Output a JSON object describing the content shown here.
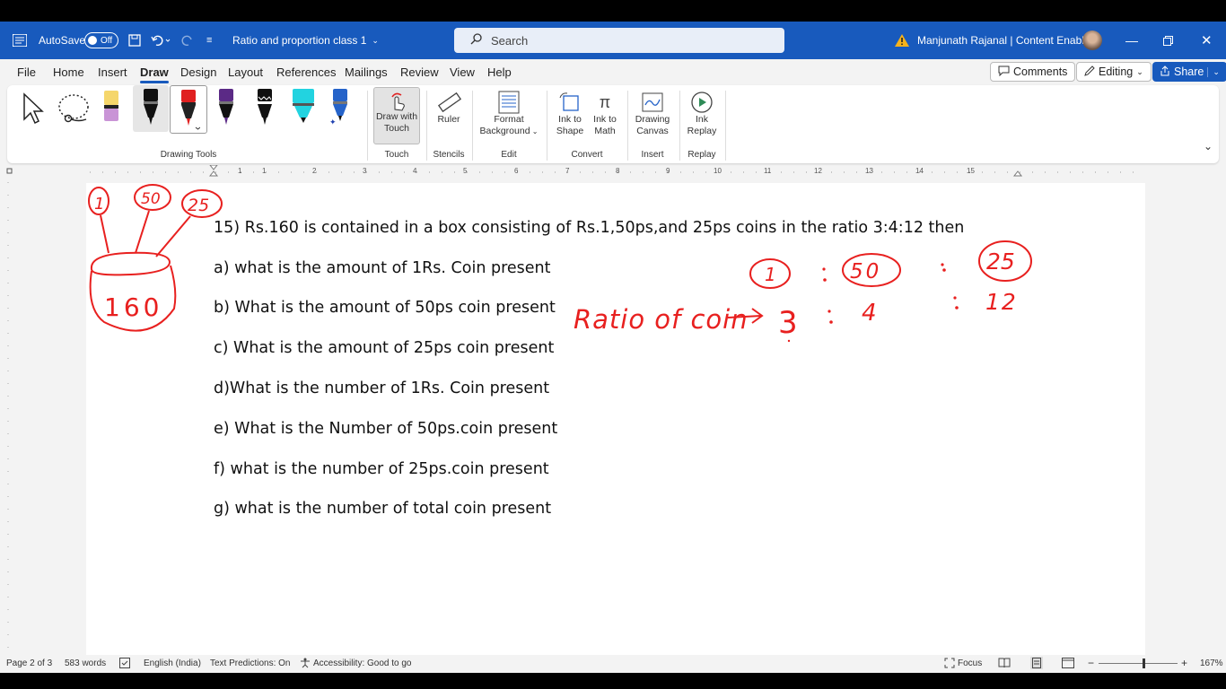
{
  "titlebar": {
    "autosave_label": "AutoSave",
    "autosave_state": "Off",
    "doc_title": "Ratio and proportion class 1",
    "search_placeholder": "Search",
    "user": "Manjunath Rajanal | Content Enablers"
  },
  "menu": {
    "tabs": [
      "File",
      "Home",
      "Insert",
      "Draw",
      "Design",
      "Layout",
      "References",
      "Mailings",
      "Review",
      "View",
      "Help"
    ],
    "active": "Draw",
    "comments_label": "Comments",
    "editing_label": "Editing",
    "share_label": "Share"
  },
  "ribbon": {
    "groups": {
      "drawing_tools": "Drawing Tools",
      "touch": "Touch",
      "stencils": "Stencils",
      "edit": "Edit",
      "convert": "Convert",
      "insert": "Insert",
      "replay": "Replay"
    },
    "buttons": {
      "draw_with_touch_1": "Draw with",
      "draw_with_touch_2": "Touch",
      "ruler": "Ruler",
      "format_bg_1": "Format",
      "format_bg_2": "Background",
      "ink_shape_1": "Ink to",
      "ink_shape_2": "Shape",
      "ink_math_1": "Ink to",
      "ink_math_2": "Math",
      "canvas_1": "Drawing",
      "canvas_2": "Canvas",
      "replay_1": "Ink",
      "replay_2": "Replay"
    },
    "pen_colors": [
      "#f5d66b",
      "#111111",
      "#e02020",
      "#5b2a86",
      "#111111",
      "#22d3e0",
      "#2563c9"
    ]
  },
  "ruler_numbers": [
    "1",
    "1",
    "2",
    "3",
    "4",
    "5",
    "6",
    "7",
    "8",
    "9",
    "10",
    "11",
    "12",
    "13",
    "14",
    "15"
  ],
  "document": {
    "lines": [
      "15)  Rs.160 is contained in a box consisting of Rs.1,50ps,and 25ps coins in the ratio 3:4:12 then",
      "a) what is the amount of 1Rs. Coin present",
      "b) What is the amount of 50ps coin present",
      "c) What is the amount of 25ps coin present",
      "d)What is the number of 1Rs. Coin present",
      "e) What is the Number of 50ps.coin present",
      "f) what is the number of 25ps.coin present",
      "g) what is the number of total coin present"
    ],
    "ink": {
      "coins": [
        "1",
        "50",
        "25"
      ],
      "box_amount": "160",
      "ratio_label": "Ratio of coin",
      "ratio_values": [
        "3",
        "4",
        "12"
      ]
    },
    "ink_color": "#e8201f"
  },
  "status": {
    "page": "Page 2 of 3",
    "words": "583 words",
    "language": "English (India)",
    "predictions": "Text Predictions: On",
    "accessibility": "Accessibility: Good to go",
    "focus": "Focus",
    "zoom": "167%"
  }
}
